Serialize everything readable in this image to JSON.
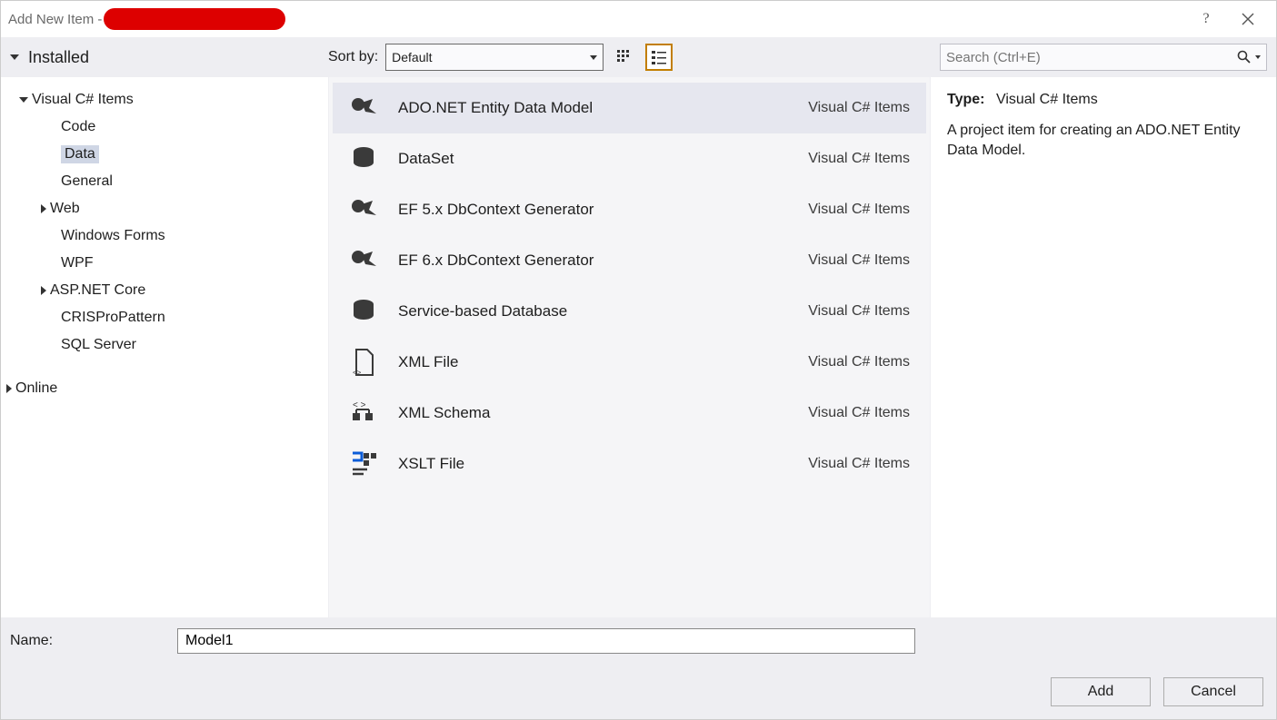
{
  "title": "Add New Item - ",
  "toolbar": {
    "installed_label": "Installed",
    "sortby_label": "Sort by:",
    "sortby_value": "Default",
    "search_placeholder": "Search (Ctrl+E)"
  },
  "tree": {
    "root": "Visual C# Items",
    "items": [
      {
        "label": "Code"
      },
      {
        "label": "Data",
        "selected": true
      },
      {
        "label": "General"
      },
      {
        "label": "Web",
        "expandable": true
      },
      {
        "label": "Windows Forms"
      },
      {
        "label": "WPF"
      },
      {
        "label": "ASP.NET Core",
        "expandable": true
      },
      {
        "label": "CRISProPattern"
      },
      {
        "label": "SQL Server"
      }
    ],
    "online_label": "Online"
  },
  "items": [
    {
      "name": "ADO.NET Entity Data Model",
      "category": "Visual C# Items",
      "icon": "edm",
      "selected": true
    },
    {
      "name": "DataSet",
      "category": "Visual C# Items",
      "icon": "db"
    },
    {
      "name": "EF 5.x DbContext Generator",
      "category": "Visual C# Items",
      "icon": "edm"
    },
    {
      "name": "EF 6.x DbContext Generator",
      "category": "Visual C# Items",
      "icon": "edm"
    },
    {
      "name": "Service-based Database",
      "category": "Visual C# Items",
      "icon": "db"
    },
    {
      "name": "XML File",
      "category": "Visual C# Items",
      "icon": "xmlf"
    },
    {
      "name": "XML Schema",
      "category": "Visual C# Items",
      "icon": "xsd"
    },
    {
      "name": "XSLT File",
      "category": "Visual C# Items",
      "icon": "xslt"
    }
  ],
  "detail": {
    "type_label": "Type:",
    "type_value": "Visual C# Items",
    "description": "A project item for creating an ADO.NET Entity Data Model."
  },
  "footer": {
    "name_label": "Name:",
    "name_value": "Model1",
    "add_label": "Add",
    "cancel_label": "Cancel"
  }
}
